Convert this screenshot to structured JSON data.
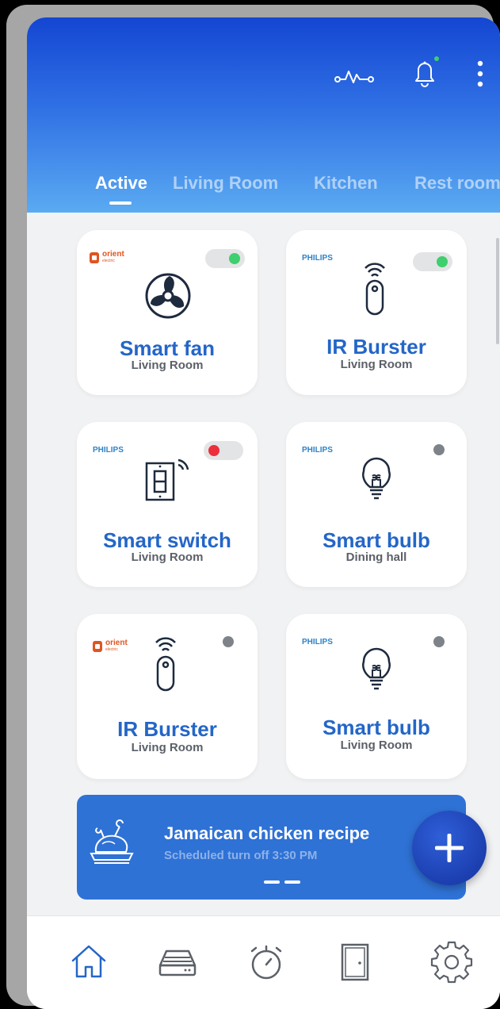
{
  "tabs": [
    {
      "label": "Active"
    },
    {
      "label": "Living Room"
    },
    {
      "label": "Kitchen"
    },
    {
      "label": "Rest room"
    }
  ],
  "devices": [
    {
      "name": "Smart fan",
      "room": "Living Room",
      "brand": "orient",
      "brand_sub": "electric",
      "state": "toggle-on"
    },
    {
      "name": "IR Burster",
      "room": "Living Room",
      "brand": "PHILIPS",
      "state": "toggle-on"
    },
    {
      "name": "Smart switch",
      "room": "Living Room",
      "brand": "PHILIPS",
      "state": "toggle-off"
    },
    {
      "name": "Smart bulb",
      "room": "Dining hall",
      "brand": "PHILIPS",
      "state": "offline"
    },
    {
      "name": "IR Burster",
      "room": "Living Room",
      "brand": "orient",
      "brand_sub": "electric",
      "state": "offline"
    },
    {
      "name": "Smart bulb",
      "room": "Living Room",
      "brand": "PHILIPS",
      "state": "offline"
    }
  ],
  "banner": {
    "title": "Jamaican chicken recipe",
    "subtitle": "Scheduled turn off 3:30 PM"
  },
  "icons": {
    "header": [
      "activity-icon",
      "bell-icon",
      "more-vertical-icon"
    ],
    "nav": [
      "home-icon",
      "hub-icon",
      "timer-icon",
      "door-icon",
      "settings-icon"
    ]
  },
  "colors": {
    "accent": "#2466c8",
    "toggle_on": "#3ecf6e",
    "toggle_off": "#ec2f3b",
    "offline_dot": "#7e8389",
    "notification_dot": "#3ecf6e"
  }
}
